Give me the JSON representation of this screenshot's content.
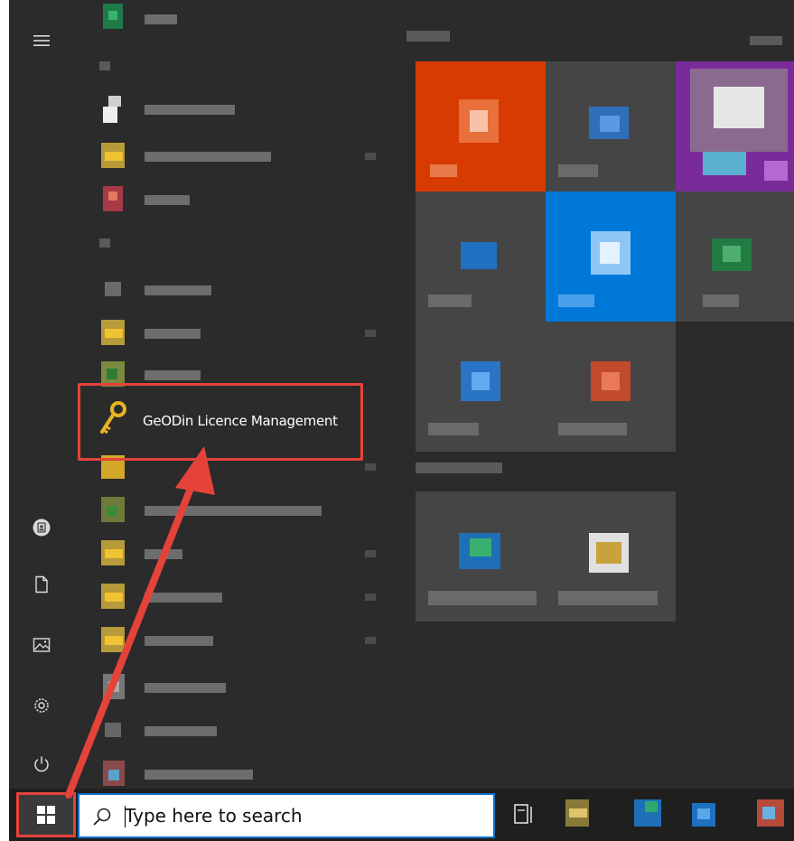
{
  "start_menu": {
    "highlighted_app": {
      "label": "GeODin Licence Management",
      "icon": "key-icon"
    },
    "rail_icons": [
      "hamburger-menu-icon",
      "user-avatar-icon",
      "documents-icon",
      "pictures-icon",
      "settings-gear-icon",
      "power-icon"
    ]
  },
  "taskbar": {
    "start_icon": "windows-logo-icon",
    "search": {
      "placeholder": "Type here to search",
      "icon": "search-icon"
    },
    "task_view_icon": "task-view-icon"
  },
  "colors": {
    "menu_bg": "#2b2b2b",
    "taskbar_bg": "#1f1f1f",
    "highlight": "#e5433a",
    "search_border": "#0a6fc9",
    "office_tile": "#d83b01",
    "blue_tile": "#0078d7",
    "purple_tile": "#7a2b9a"
  }
}
